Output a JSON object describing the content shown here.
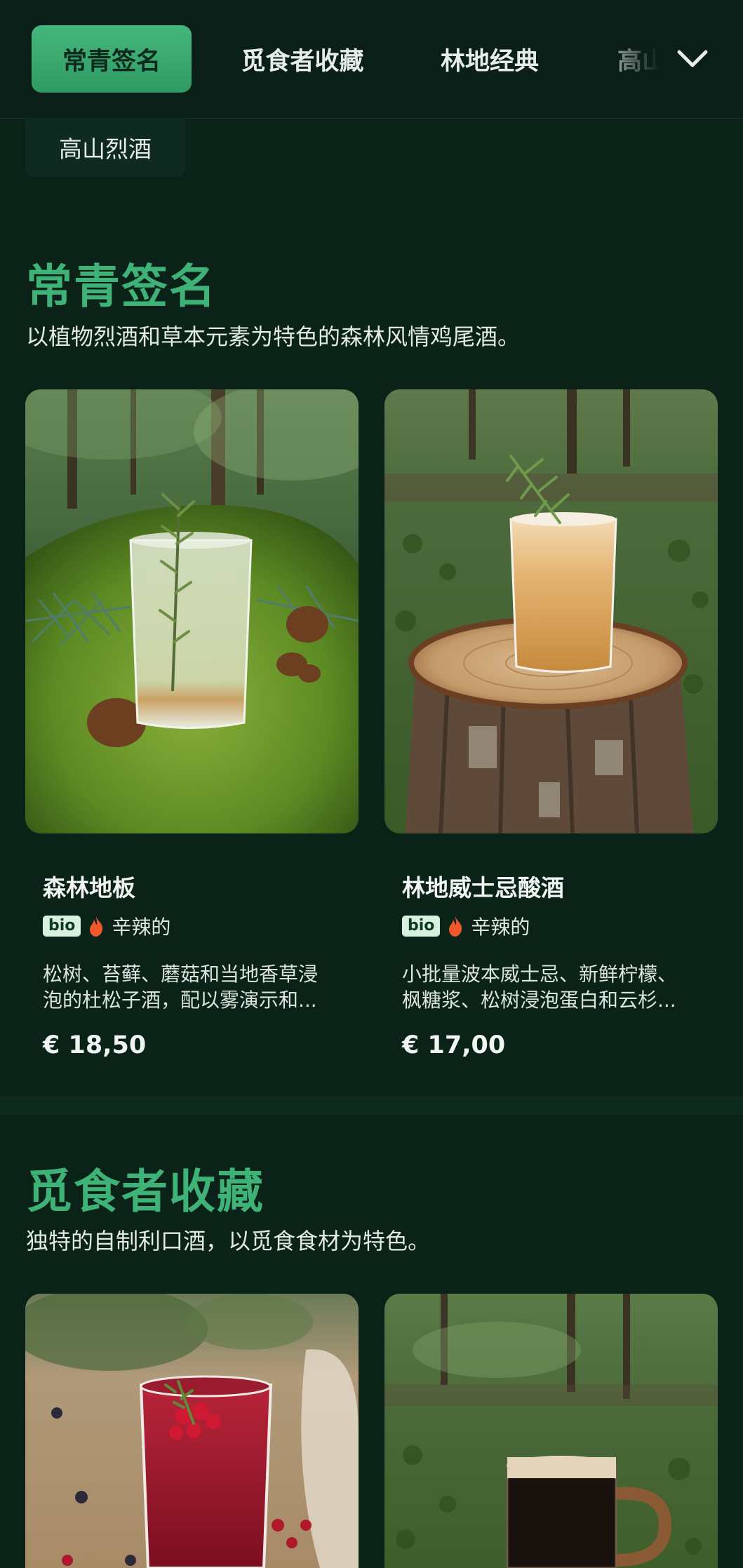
{
  "tabs": [
    {
      "label": "常青签名",
      "active": true
    },
    {
      "label": "觅食者收藏",
      "active": false
    },
    {
      "label": "林地经典",
      "active": false
    },
    {
      "label": "高山烈酒",
      "active": false
    }
  ],
  "tab_partial_label": "高山",
  "wrapped_tab_label": "高山烈酒",
  "sections": [
    {
      "title": "常青签名",
      "subtitle": "以植物烈酒和草本元素为特色的森林风情鸡尾酒。",
      "items": [
        {
          "name": "森林地板",
          "badge": "bio",
          "tag": "辛辣的",
          "desc_line1": "松树、苔藓、蘑菇和当地香草浸",
          "desc_line2": "泡的杜松子酒，配以雾演示和...",
          "price": "€ 18,50",
          "image": "cocktail-on-moss-photo"
        },
        {
          "name": "林地威士忌酸酒",
          "badge": "bio",
          "tag": "辛辣的",
          "desc_line1": "小批量波本威士忌、新鲜柠檬、",
          "desc_line2": "枫糖浆、松树浸泡蛋白和云杉...",
          "price": "€ 17,00",
          "image": "cocktail-on-stump-photo"
        }
      ]
    },
    {
      "title": "觅食者收藏",
      "subtitle": "独特的自制利口酒，以觅食食材为特色。",
      "items": [
        {
          "image": "berry-liqueur-photo"
        },
        {
          "image": "dark-beer-mug-photo"
        }
      ]
    }
  ],
  "colors": {
    "background": "#0b2219",
    "accent": "#3fb277",
    "active_tab": "#3aa86e",
    "spicy_icon": "#f0582b"
  },
  "icons": [
    "chevron-down-icon",
    "flame-icon"
  ]
}
